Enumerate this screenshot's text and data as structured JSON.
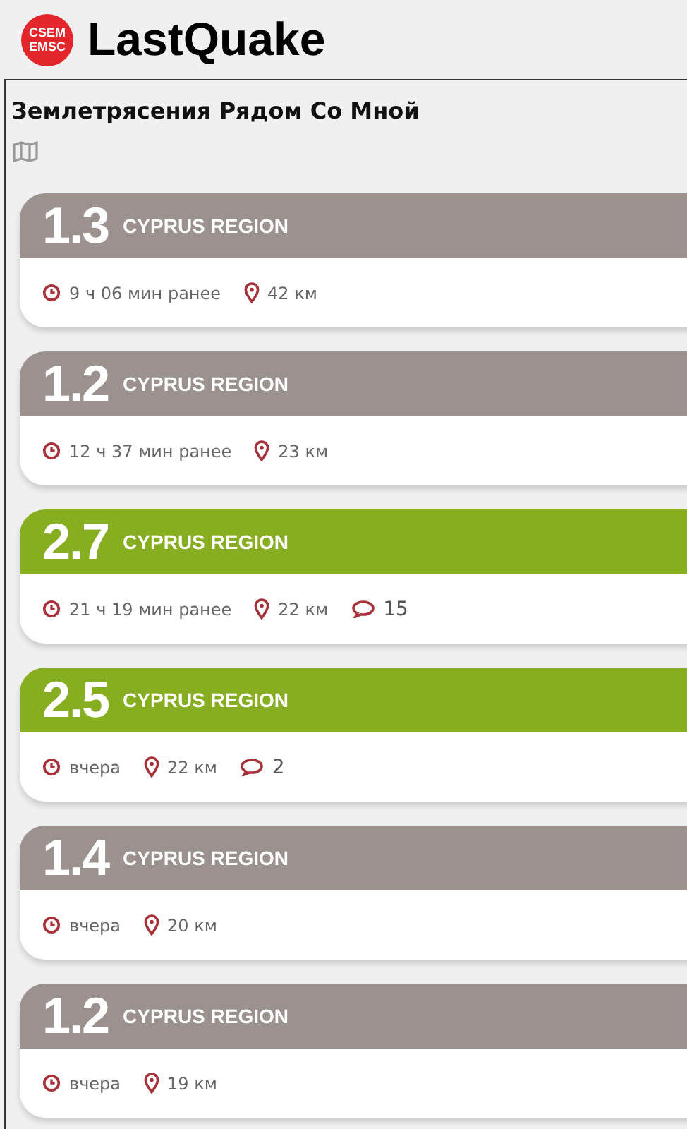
{
  "app": {
    "logo_lines": [
      "CSEM",
      "EMSC"
    ],
    "title": "LastQuake"
  },
  "panel": {
    "title": "Землетрясения Рядом Со Мной"
  },
  "quakes": [
    {
      "magnitude": "1.3",
      "region": "CYPRUS REGION",
      "color": "#9b918e",
      "time": "9 ч 06 мин ранее",
      "distance": "42 км"
    },
    {
      "magnitude": "1.2",
      "region": "CYPRUS REGION",
      "color": "#9b918e",
      "time": "12 ч 37 мин ранее",
      "distance": "23 км"
    },
    {
      "magnitude": "2.7",
      "region": "CYPRUS REGION",
      "color": "#87ae21",
      "time": "21 ч 19 мин ранее",
      "distance": "22 км",
      "comments": "15"
    },
    {
      "magnitude": "2.5",
      "region": "CYPRUS REGION",
      "color": "#87ae21",
      "time": "вчера",
      "distance": "22 км",
      "comments": "2"
    },
    {
      "magnitude": "1.4",
      "region": "CYPRUS REGION",
      "color": "#9b918e",
      "time": "вчера",
      "distance": "20 км"
    },
    {
      "magnitude": "1.2",
      "region": "CYPRUS REGION",
      "color": "#9b918e",
      "time": "вчера",
      "distance": "19 км"
    }
  ]
}
